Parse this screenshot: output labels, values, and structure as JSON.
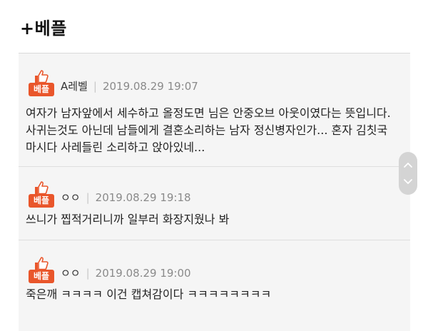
{
  "header": {
    "title": "+베플"
  },
  "badge": {
    "label": "베플",
    "icon": "thumbs-up-icon",
    "color": "#e9562b"
  },
  "comments": [
    {
      "author": "A레벨",
      "timestamp": "2019.08.29 19:07",
      "lines": [
        "여자가 남자앞에서 세수하고 올정도면 님은 안중오브 아웃이였다는 뜻입니다.",
        "사귀는것도 아닌데 남들에게 결혼소리하는 남자 정신병자인가... 혼자 김칫국",
        "마시다 사레들린 소리하고 앉아있네..."
      ]
    },
    {
      "author": "ㅇㅇ",
      "timestamp": "2019.08.29 19:18",
      "lines": [
        "쓰니가 찝적거리니까 일부러 화장지웠나 봐"
      ]
    },
    {
      "author": "ㅇㅇ",
      "timestamp": "2019.08.29 19:00",
      "lines": [
        "죽은깨 ㅋㅋㅋㅋ 이건 캡쳐감이다 ㅋㅋㅋㅋㅋㅋㅋㅋ"
      ]
    }
  ],
  "scroll": {
    "up_icon": "chevron-up-icon",
    "down_icon": "chevron-down-icon"
  }
}
